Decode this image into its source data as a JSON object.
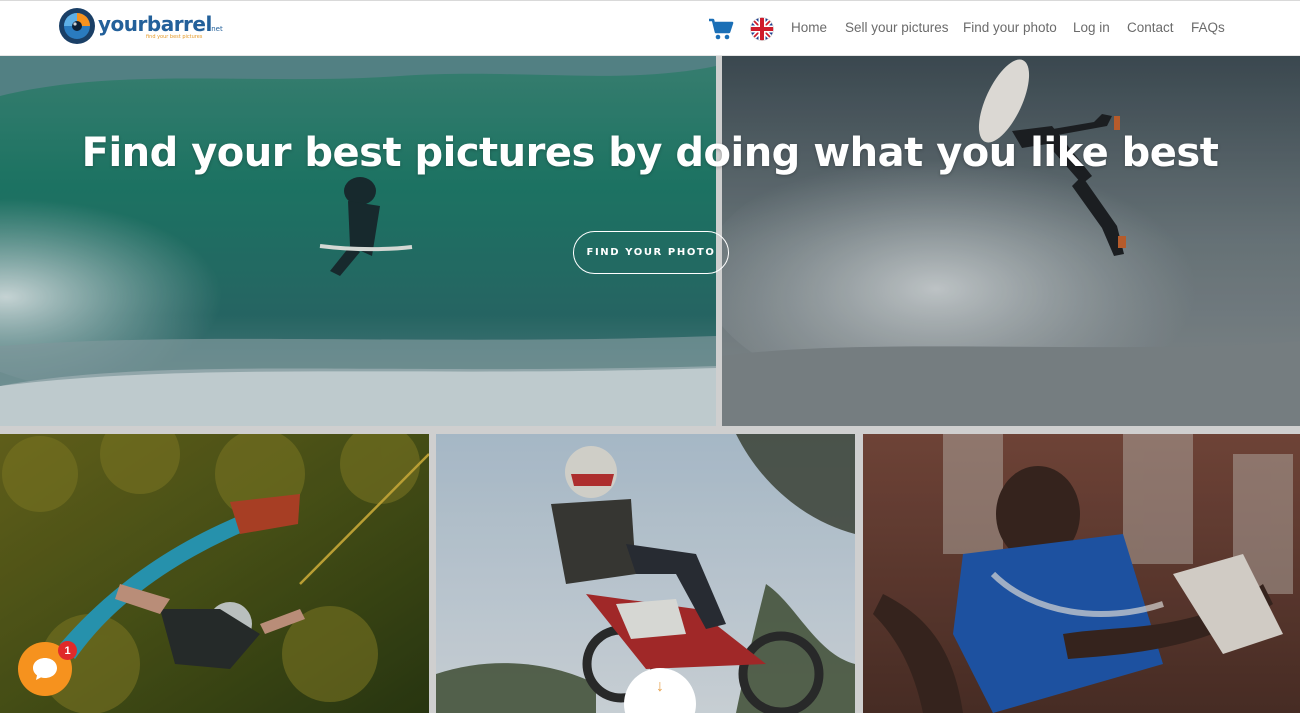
{
  "header": {
    "logo": {
      "word": "yourbarrel",
      "suffix": ".net",
      "tagline": "find your best pictures"
    },
    "cart_icon": "shopping-cart-icon",
    "language_icon": "uk-flag-icon",
    "nav": [
      {
        "label": "Home"
      },
      {
        "label": "Sell your pictures"
      },
      {
        "label": "Find your photo"
      },
      {
        "label": "Log in"
      },
      {
        "label": "Contact"
      },
      {
        "label": "FAQs"
      }
    ]
  },
  "hero": {
    "title": "Find your best pictures by doing what you like best",
    "cta_label": "FIND YOUR PHOTO"
  },
  "tiles": [
    {
      "subject": "surfer-barrel-photo"
    },
    {
      "subject": "surfer-aerial-photo"
    },
    {
      "subject": "wakeboarder-photo"
    },
    {
      "subject": "motocross-jump-photo"
    },
    {
      "subject": "basketball-player-photo"
    }
  ],
  "chat": {
    "icon": "chat-bubble-icon",
    "badge_count": "1"
  },
  "scroll_icon": "arrow-down-icon",
  "colors": {
    "brand_blue": "#23609a",
    "accent_orange": "#f6921e",
    "nav_text": "#6b6b6b",
    "badge_red": "#e02a2a"
  }
}
